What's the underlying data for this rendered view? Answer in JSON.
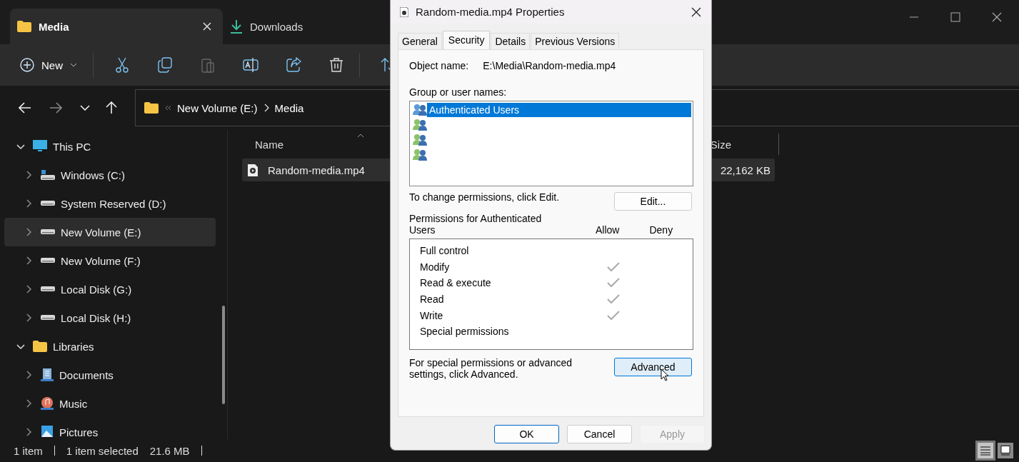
{
  "explorer": {
    "tabs": [
      {
        "label": "Media",
        "kind": "folder",
        "selected": true
      },
      {
        "label": "Downloads",
        "kind": "download",
        "selected": false
      }
    ],
    "new_button": "New",
    "breadcrumb": [
      "New Volume (E:)",
      "Media"
    ],
    "nav_tree": [
      {
        "label": "This PC",
        "kind": "pc",
        "expanded": true,
        "selected": false,
        "children": [
          {
            "label": "Windows (C:)",
            "kind": "os-drive",
            "expanded": false,
            "selected": false
          },
          {
            "label": "System Reserved (D:)",
            "kind": "drive",
            "expanded": false,
            "selected": false
          },
          {
            "label": "New Volume (E:)",
            "kind": "drive",
            "expanded": false,
            "selected": true
          },
          {
            "label": "New Volume (F:)",
            "kind": "drive",
            "expanded": false,
            "selected": false
          },
          {
            "label": "Local Disk (G:)",
            "kind": "drive",
            "expanded": false,
            "selected": false
          },
          {
            "label": "Local Disk (H:)",
            "kind": "drive",
            "expanded": false,
            "selected": false
          }
        ]
      },
      {
        "label": "Libraries",
        "kind": "folder",
        "expanded": true,
        "selected": false,
        "children": [
          {
            "label": "Documents",
            "kind": "documents",
            "expanded": false,
            "selected": false
          },
          {
            "label": "Music",
            "kind": "music",
            "expanded": false,
            "selected": false
          },
          {
            "label": "Pictures",
            "kind": "pictures",
            "expanded": false,
            "selected": false
          }
        ]
      }
    ],
    "columns": {
      "name": "Name",
      "size": "Size"
    },
    "files": [
      {
        "name": "Random-media.mp4",
        "size": "22,162 KB",
        "selected": true
      }
    ],
    "status_bar": {
      "count": "1 item",
      "selection": "1 item selected",
      "size": "21.6 MB"
    },
    "view_buttons": [
      {
        "kind": "details",
        "selected": true
      },
      {
        "kind": "tiles",
        "selected": false
      }
    ]
  },
  "dialog": {
    "title": "Random-media.mp4 Properties",
    "tabs": [
      {
        "label": "General",
        "selected": false
      },
      {
        "label": "Security",
        "selected": true
      },
      {
        "label": "Details",
        "selected": false
      },
      {
        "label": "Previous Versions",
        "selected": false
      }
    ],
    "object_label": "Object name:",
    "object_value": "E:\\Media\\Random-media.mp4",
    "groups_label": "Group or user names:",
    "groups": [
      {
        "name": "Authenticated Users",
        "selected": true
      },
      {
        "selected": false
      },
      {
        "selected": false
      },
      {
        "selected": false
      }
    ],
    "change_hint": "To change permissions, click Edit.",
    "edit_button": "Edit...",
    "permissions_label": "Permissions for Authenticated Users",
    "allow_label": "Allow",
    "deny_label": "Deny",
    "permissions": [
      {
        "name": "Full control",
        "allow": false
      },
      {
        "name": "Modify",
        "allow": true
      },
      {
        "name": "Read & execute",
        "allow": true
      },
      {
        "name": "Read",
        "allow": true
      },
      {
        "name": "Write",
        "allow": true
      },
      {
        "name": "Special permissions",
        "allow": false
      }
    ],
    "advanced_hint": "For special permissions or advanced settings, click Advanced.",
    "advanced_button": {
      "label": "Advanced",
      "hovered": true
    },
    "buttons": [
      {
        "label": "OK",
        "kind": "default",
        "disabled": false
      },
      {
        "label": "Cancel",
        "kind": "normal",
        "disabled": false
      },
      {
        "label": "Apply",
        "kind": "normal",
        "disabled": true
      }
    ]
  }
}
